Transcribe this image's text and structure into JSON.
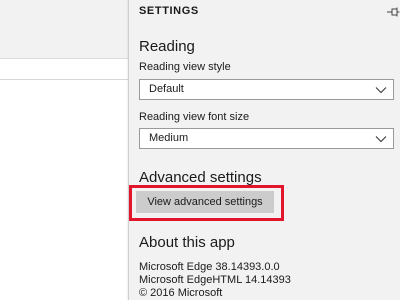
{
  "settings": {
    "title": "SETTINGS",
    "pin_icon": "pin-icon",
    "reading": {
      "heading": "Reading",
      "view_style_label": "Reading view style",
      "view_style_value": "Default",
      "font_size_label": "Reading view font size",
      "font_size_value": "Medium"
    },
    "advanced": {
      "heading": "Advanced settings",
      "button_label": "View advanced settings"
    },
    "about": {
      "heading": "About this app",
      "edge_version": "Microsoft Edge 38.14393.0.0",
      "edgehtml_version": "Microsoft EdgeHTML 14.14393",
      "copyright": "© 2016 Microsoft"
    }
  },
  "colors": {
    "panel_bg": "#f2f2f2",
    "button_bg": "#cccccc",
    "highlight": "#e1162d"
  }
}
